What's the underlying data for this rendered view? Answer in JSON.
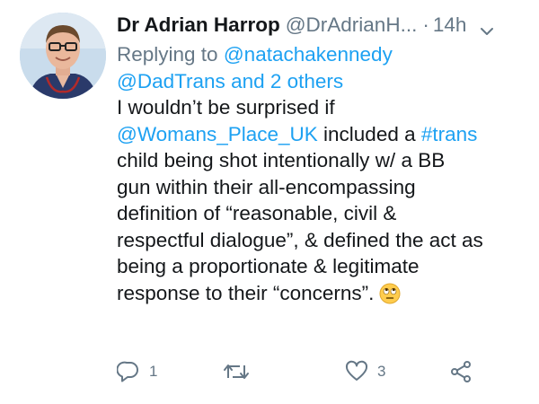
{
  "tweet": {
    "author_name": "Dr Adrian Harrop",
    "author_handle": "@DrAdrianH...",
    "separator": "·",
    "timestamp": "14h",
    "replying_prefix": "Replying to",
    "replying_to_1": "@natachakennedy",
    "replying_to_2": "@DadTrans",
    "replying_and": "and",
    "replying_others": "2 others",
    "body": {
      "l1": "I wouldn’t be surprised if",
      "l2_mention": "@Womans_Place_UK",
      "l2_mid": " included a ",
      "l2_hashtag": "#trans",
      "l3": "child being shot intentionally w/ a BB",
      "l4": "gun within their all-encompassing",
      "l5": "definition of “reasonable, civil &",
      "l6": "respectful dialogue”, & defined the act as",
      "l7": "being a proportionate & legitimate",
      "l8": "response to their “concerns”."
    },
    "emoji": "face-with-rolling-eyes-icon"
  },
  "actions": {
    "reply_count": "1",
    "retweet_count": "",
    "like_count": "3"
  },
  "colors": {
    "link": "#1da1f2",
    "secondary": "#657786",
    "text": "#14171a"
  }
}
